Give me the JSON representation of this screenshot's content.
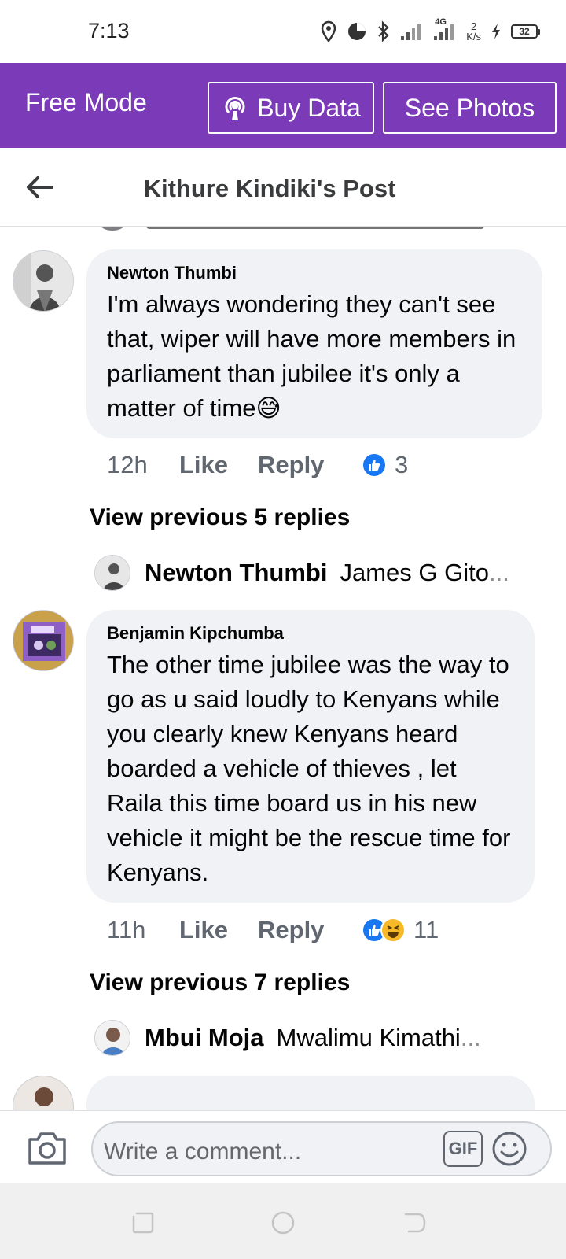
{
  "status_bar": {
    "time": "7:13",
    "network": "4G",
    "speed_value": "2",
    "speed_unit": "K/s",
    "battery": "32"
  },
  "free_mode": {
    "label": "Free Mode",
    "buy_data": "Buy Data",
    "see_photos": "See Photos"
  },
  "header": {
    "title": "Kithure Kindiki's Post"
  },
  "comments": [
    {
      "author": "Newton Thumbi",
      "text": "I'm always wondering they can't see that, wiper will have more members in parliament than jubilee it's only a matter of time😅",
      "time": "12h",
      "like": "Like",
      "reply": "Reply",
      "reaction_count": "3",
      "view_previous": "View previous 5 replies",
      "preview_author": "Newton Thumbi",
      "preview_text": "James G Gito",
      "preview_ellipsis": "..."
    },
    {
      "author": "Benjamin Kipchumba",
      "text": "The other time jubilee was the way to go as u said loudly to Kenyans while you clearly knew Kenyans heard boarded a vehicle of thieves , let Raila this time board us in his new vehicle it might be the rescue time for Kenyans.",
      "time": "11h",
      "like": "Like",
      "reply": "Reply",
      "reaction_count": "11",
      "view_previous": "View previous 7 replies",
      "preview_author": "Mbui Moja",
      "preview_text": "Mwalimu Kimathi",
      "preview_ellipsis": "..."
    }
  ],
  "compose": {
    "placeholder": "Write a comment...",
    "gif": "GIF"
  },
  "colors": {
    "free_mode_purple": "#7b3ab8",
    "facebook_blue": "#1877f2",
    "bubble_grey": "#f0f2f5"
  }
}
